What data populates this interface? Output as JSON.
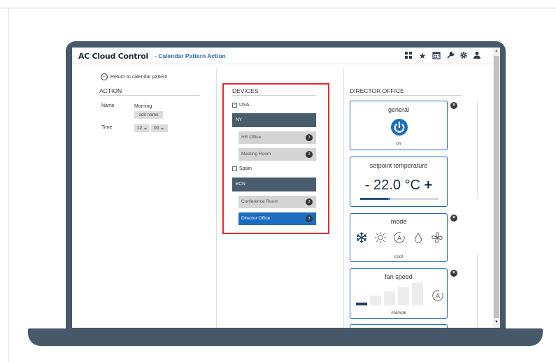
{
  "app": {
    "title": "AC Cloud Control",
    "subtitle": "- Calendar Pattern Action",
    "accent_color": "#1c6cbf",
    "header_icons": [
      "dashboard-icon",
      "star-icon",
      "calendar-icon",
      "wrench-icon",
      "gear-icon",
      "user-icon"
    ]
  },
  "action": {
    "return_link": "Return to calendar pattern",
    "title": "ACTION",
    "name_label": "Name",
    "name_value": "Morning",
    "edit_button": "edit name",
    "time_label": "Time",
    "hour": "12",
    "minute": "00"
  },
  "devices": {
    "title": "DEVICES",
    "groups": [
      {
        "country": "USA",
        "city": "NY",
        "rooms": [
          {
            "name": "HR Office",
            "count": "3",
            "selected": false
          },
          {
            "name": "Meeting Room",
            "count": "3",
            "selected": false
          }
        ]
      },
      {
        "country": "Spain",
        "city": "BCN",
        "rooms": [
          {
            "name": "Conference Room",
            "count": "3",
            "selected": false
          },
          {
            "name": "Director Office",
            "count": "3",
            "selected": true
          }
        ]
      }
    ]
  },
  "director": {
    "title": "DIRECTOR OFFICE",
    "general": {
      "title": "general",
      "status": "on"
    },
    "setpoint": {
      "title": "setpoint temperature",
      "minus": "-",
      "value": "22.0 °C",
      "plus": "+",
      "level": 0.38
    },
    "mode": {
      "title": "mode",
      "status": "cool",
      "options": [
        "snowflake-icon",
        "sun-icon",
        "auto-icon",
        "drop-icon",
        "fan-icon"
      ],
      "selected": "snowflake-icon"
    },
    "fan": {
      "title": "fan speed",
      "status": "manual",
      "level": 1,
      "levels": 5
    }
  }
}
